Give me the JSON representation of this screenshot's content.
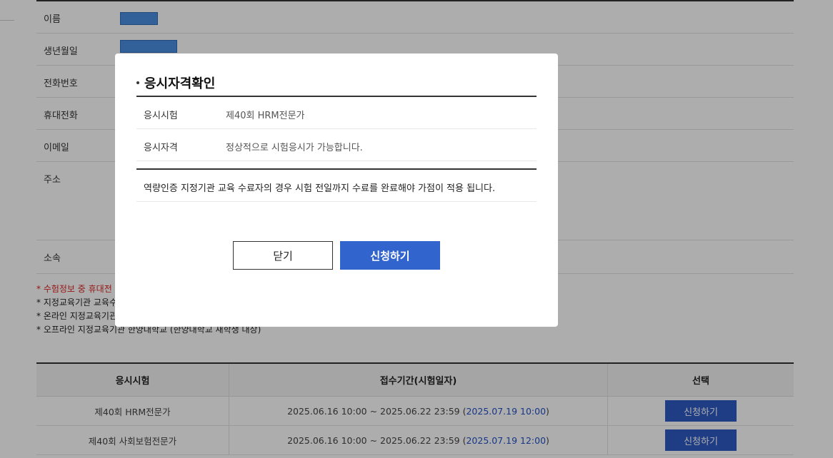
{
  "form": {
    "rows": [
      {
        "label": "이름"
      },
      {
        "label": "생년월일"
      },
      {
        "label": "전화번호"
      },
      {
        "label": "휴대전화"
      },
      {
        "label": "이메일"
      },
      {
        "label": "주소"
      },
      {
        "label": "소속"
      }
    ]
  },
  "notes": {
    "line1": "* 수험정보 중 휴대전",
    "line2": "* 지정교육기관 교육수",
    "line3": "* 온라인 지정교육기관",
    "line4": "* 오프라인 지정교육기관 한양대학교 (한양대학교 재학생 대상)"
  },
  "exam_table": {
    "headers": [
      "응시시험",
      "접수기간(시험일자)",
      "선택"
    ],
    "rows": [
      {
        "name": "제40회 HRM전문가",
        "period": "2025.06.16 10:00 ~ 2025.06.22 23:59 (",
        "date": "2025.07.19 10:00",
        "close": ")",
        "button": "신청하기"
      },
      {
        "name": "제40회 사회보험전문가",
        "period": "2025.06.16 10:00 ~ 2025.06.22 23:59 (",
        "date": "2025.07.19 12:00",
        "close": ")",
        "button": "신청하기"
      }
    ]
  },
  "modal": {
    "title": "응시자격확인",
    "rows": [
      {
        "label": "응시시험",
        "value": "제40회 HRM전문가"
      },
      {
        "label": "응시자격",
        "value": "정상적으로 시험응시가 가능합니다."
      }
    ],
    "notice": "역량인증 지정기관 교육 수료자의 경우 시험 전일까지 수료를 완료해야 가점이 적용 됩니다.",
    "close_label": "닫기",
    "apply_label": "신청하기"
  },
  "colors": {
    "primary": "#3164cc",
    "accent_date": "#2250c8",
    "warning": "#dd2222"
  }
}
